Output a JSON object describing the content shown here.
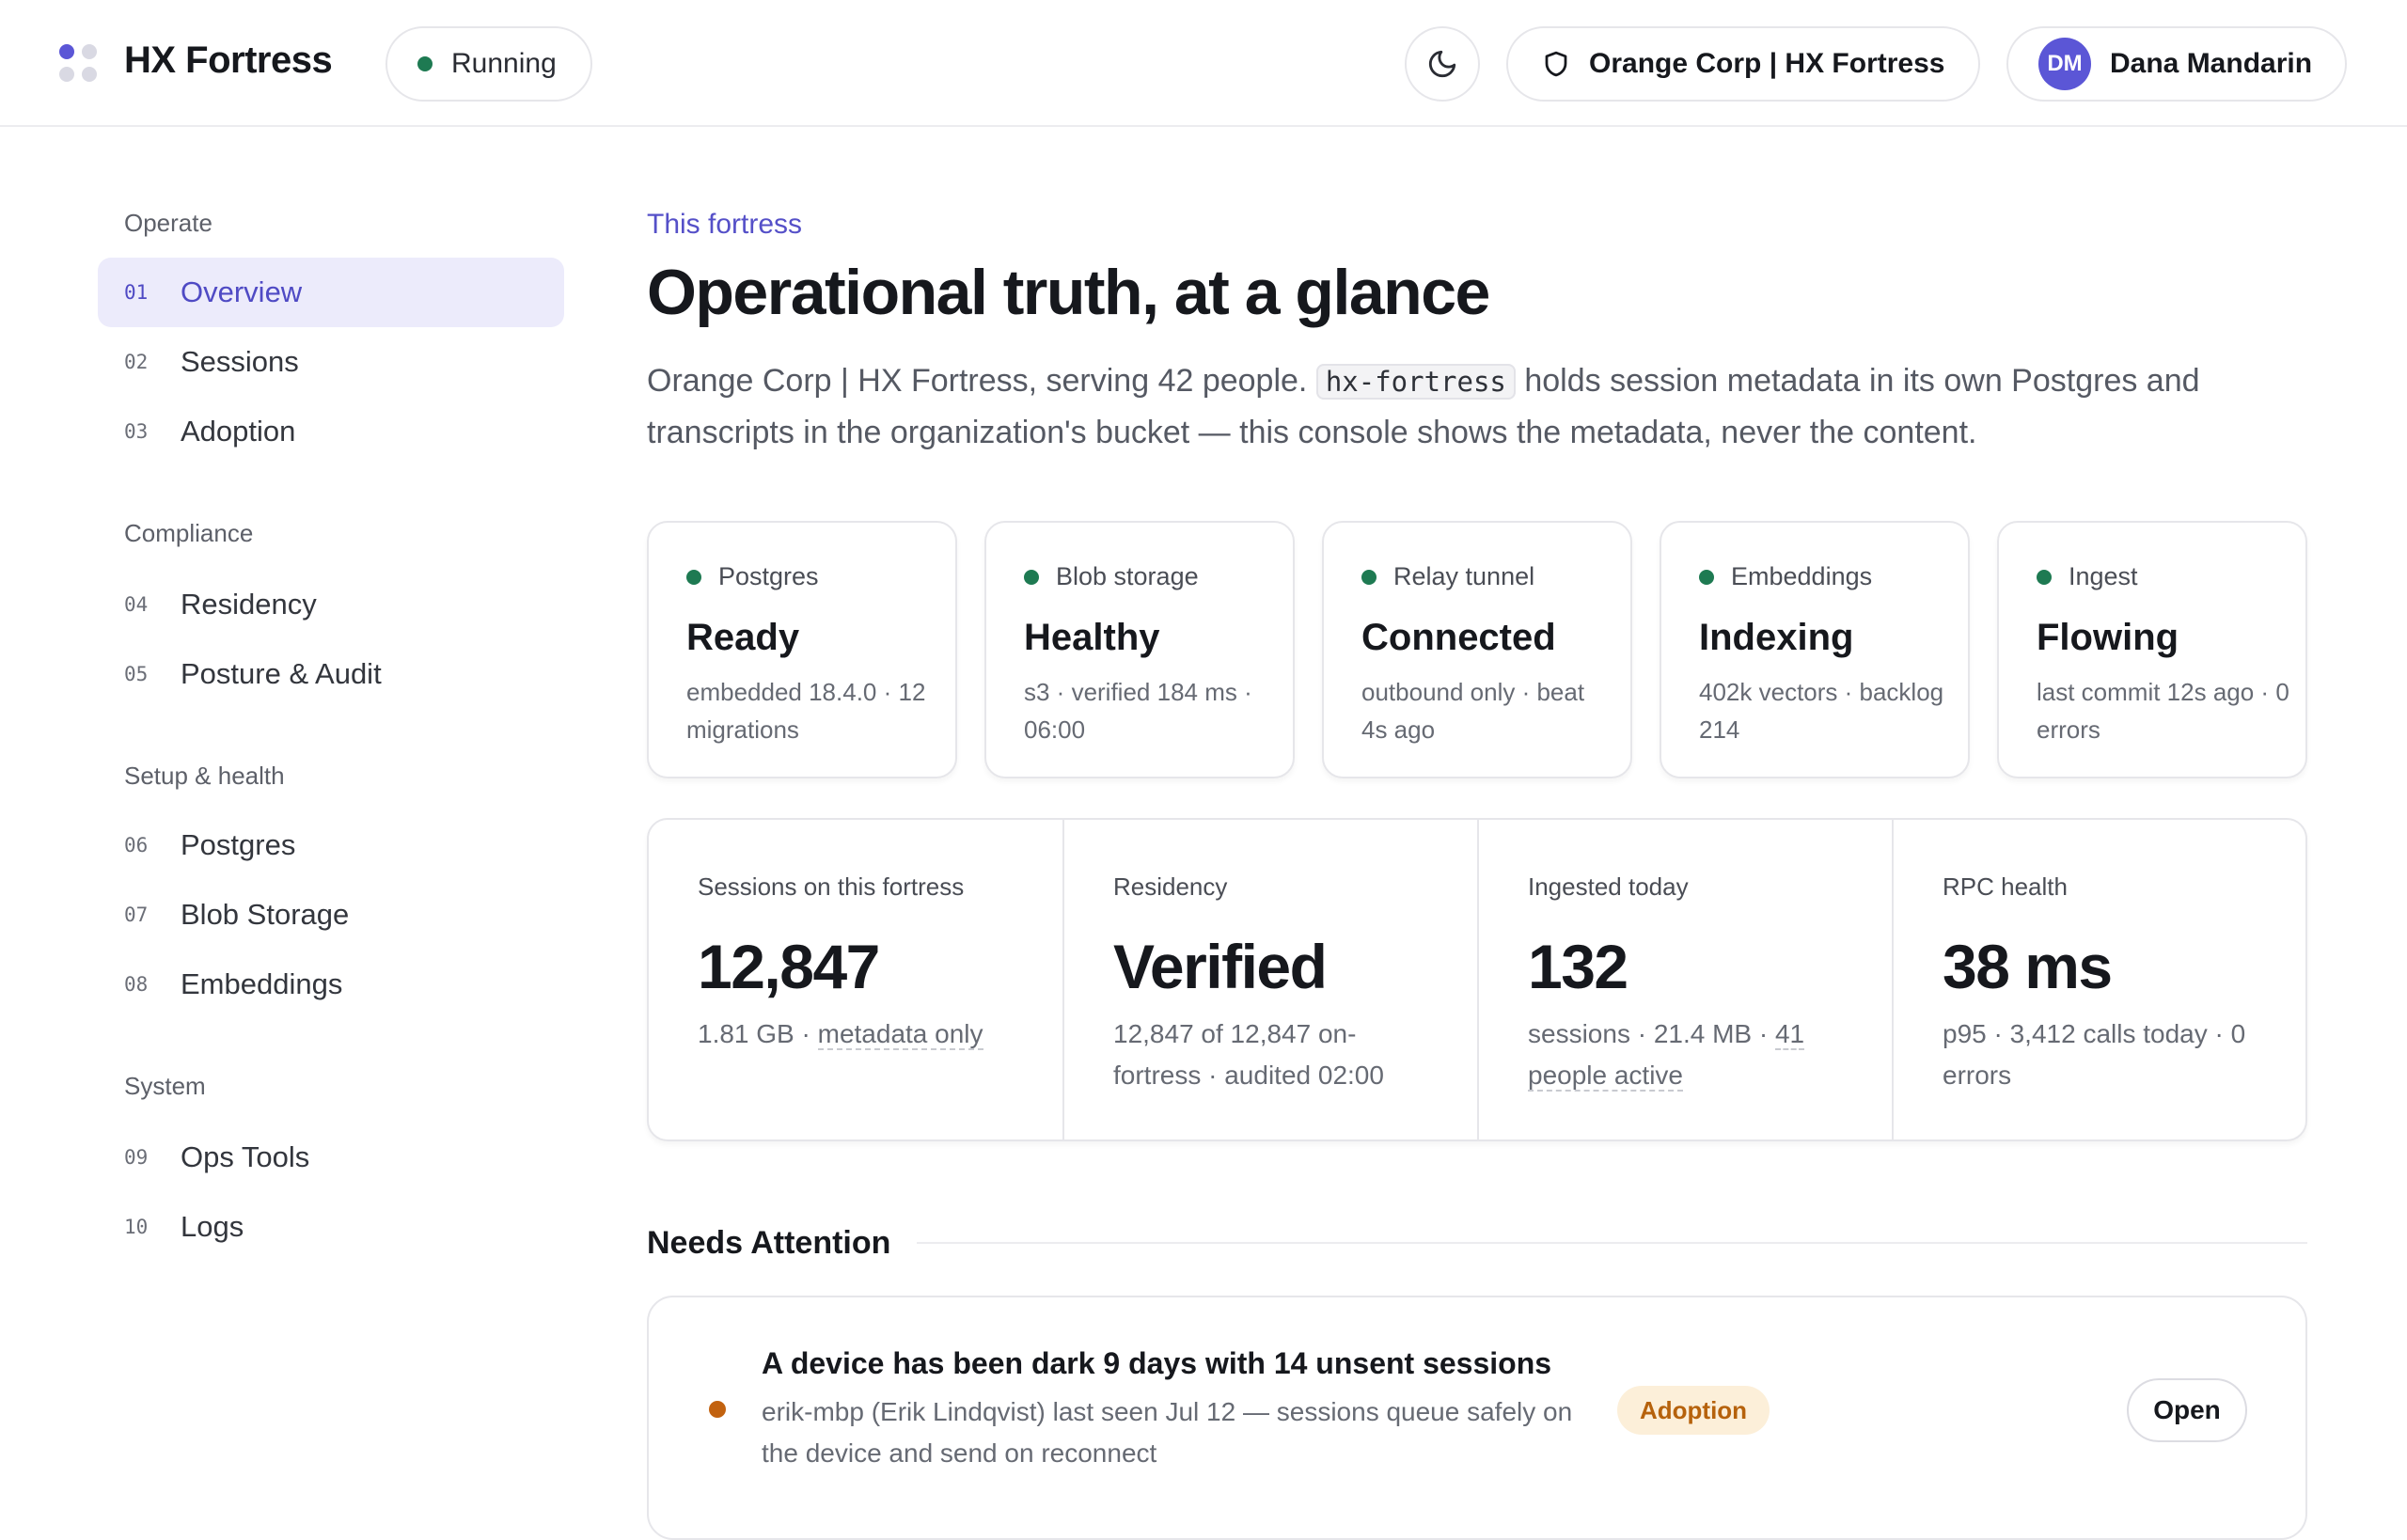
{
  "header": {
    "brand": "HX Fortress",
    "status": "Running",
    "org": "Orange Corp | HX Fortress",
    "user": {
      "initials": "DM",
      "name": "Dana Mandarin"
    }
  },
  "sidebar": {
    "groups": [
      {
        "title": "Operate",
        "items": [
          {
            "num": "01",
            "label": "Overview",
            "active": true
          },
          {
            "num": "02",
            "label": "Sessions"
          },
          {
            "num": "03",
            "label": "Adoption"
          }
        ]
      },
      {
        "title": "Compliance",
        "items": [
          {
            "num": "04",
            "label": "Residency"
          },
          {
            "num": "05",
            "label": "Posture & Audit"
          }
        ]
      },
      {
        "title": "Setup & health",
        "items": [
          {
            "num": "06",
            "label": "Postgres"
          },
          {
            "num": "07",
            "label": "Blob Storage"
          },
          {
            "num": "08",
            "label": "Embeddings"
          }
        ]
      },
      {
        "title": "System",
        "items": [
          {
            "num": "09",
            "label": "Ops Tools"
          },
          {
            "num": "10",
            "label": "Logs"
          }
        ]
      }
    ]
  },
  "main": {
    "eyebrow": "This fortress",
    "title": "Operational truth, at a glance",
    "lede_before": "Orange Corp | HX Fortress, serving 42 people. ",
    "lede_code": "hx-fortress",
    "lede_after": " holds session metadata in its own Postgres and transcripts in the organization's bucket — this console shows the metadata, never the content.",
    "cards": [
      {
        "name": "Postgres",
        "status": "Ready",
        "detail": "embedded 18.4.0 · 12 migrations"
      },
      {
        "name": "Blob storage",
        "status": "Healthy",
        "detail": "s3 · verified 184 ms · 06:00"
      },
      {
        "name": "Relay tunnel",
        "status": "Connected",
        "detail": "outbound only · beat 4s ago"
      },
      {
        "name": "Embeddings",
        "status": "Indexing",
        "detail": "402k vectors · backlog 214"
      },
      {
        "name": "Ingest",
        "status": "Flowing",
        "detail": "last commit 12s ago · 0 errors"
      }
    ],
    "stats": [
      {
        "label": "Sessions on this fortress",
        "value": "12,847",
        "desc_a": "1.81 GB · ",
        "desc_b": "metadata only"
      },
      {
        "label": "Residency",
        "value": "Verified",
        "desc_a": "12,847 of 12,847 on-fortress · audited 02:00",
        "desc_b": ""
      },
      {
        "label": "Ingested today",
        "value": "132",
        "desc_a": "sessions · 21.4 MB · ",
        "desc_b": "41 people active"
      },
      {
        "label": "RPC health",
        "value": "38 ms",
        "desc_a": "p95 · 3,412 calls today · 0 errors",
        "desc_b": ""
      }
    ],
    "attention": {
      "title": "Needs Attention",
      "items": [
        {
          "title": "A device has been dark 9 days with 14 unsent sessions",
          "desc": "erik-mbp (Erik Lindqvist) last seen Jul 12 — sessions queue safely on the device and send on reconnect",
          "tag": "Adoption",
          "action": "Open"
        }
      ]
    }
  },
  "colors": {
    "accent": "#5b56d6",
    "ok": "#1e7a52",
    "warn": "#c2620f"
  }
}
